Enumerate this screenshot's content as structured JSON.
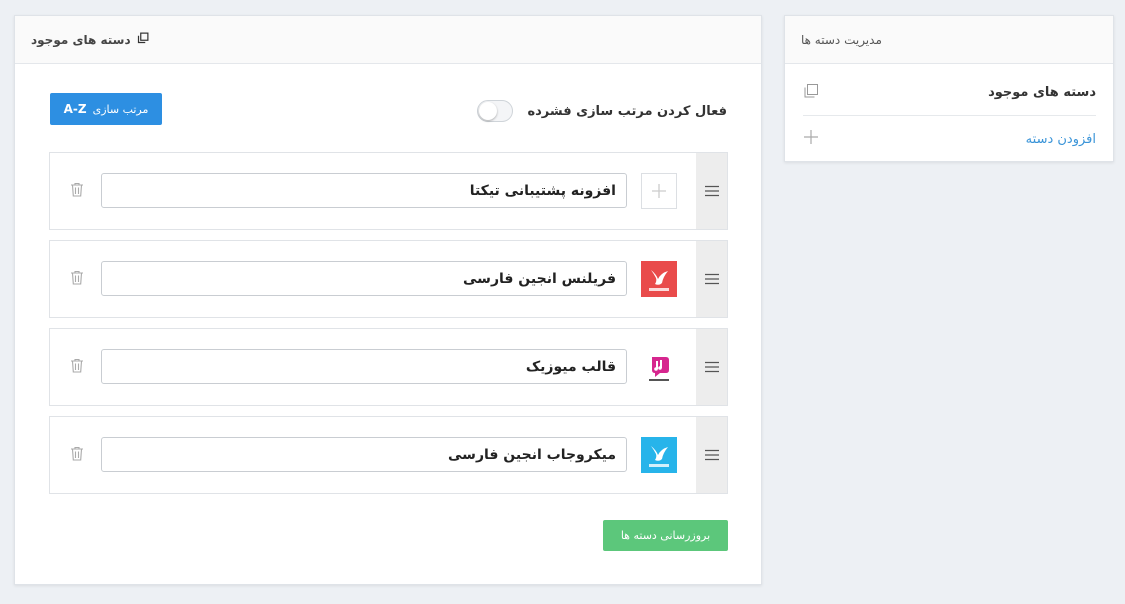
{
  "sidebar": {
    "title": "مدیریت دسته ها",
    "items": [
      {
        "label": "دسته های موجود",
        "icon": "copy-icon"
      },
      {
        "label": "افزودن دسته",
        "icon": "plus-icon"
      }
    ]
  },
  "main": {
    "title": "دسته های موجود",
    "title_icon": "copy-icon",
    "sort_button": {
      "label": "مرتب سازی",
      "az": "A-Z"
    },
    "toggle_label": "فعال کردن مرتب سازی فشرده",
    "toggle_on": false,
    "categories": [
      {
        "name": "افزونه پشتیبانی تیکتا",
        "thumb": "placeholder-plus-icon"
      },
      {
        "name": "فریلنس انجین فارسی",
        "thumb": "freelance-engine-logo",
        "color": "#e94b4b"
      },
      {
        "name": "قالب میوزیک",
        "thumb": "music-theme-logo",
        "color": "#d6268e"
      },
      {
        "name": "میکروجاب انجین فارسی",
        "thumb": "microjob-engine-logo",
        "color": "#27b4ea"
      }
    ],
    "update_button": "بروزرسانی دسته ها"
  },
  "colors": {
    "primary": "#2d8fe2",
    "success": "#5cc77b",
    "link": "#3a94d8"
  }
}
